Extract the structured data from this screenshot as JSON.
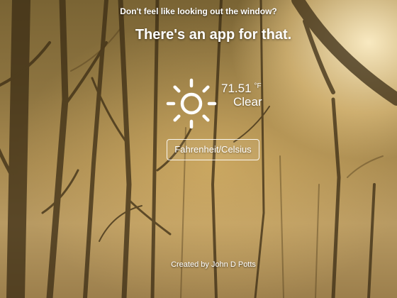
{
  "page": {
    "tagline": "Don't feel like looking out the window?",
    "headline": "There's an app for that."
  },
  "weather": {
    "icon": "sun-icon",
    "temperature": "71.51",
    "unit": "°F",
    "condition": "Clear"
  },
  "controls": {
    "unit_toggle_label": "Fahrenheit/Celsius"
  },
  "footer": {
    "credit": "Created by John D Potts"
  },
  "colors": {
    "text": "#ffffff",
    "background_warm": "#a88a50",
    "sunlight": "#fff0c8"
  }
}
